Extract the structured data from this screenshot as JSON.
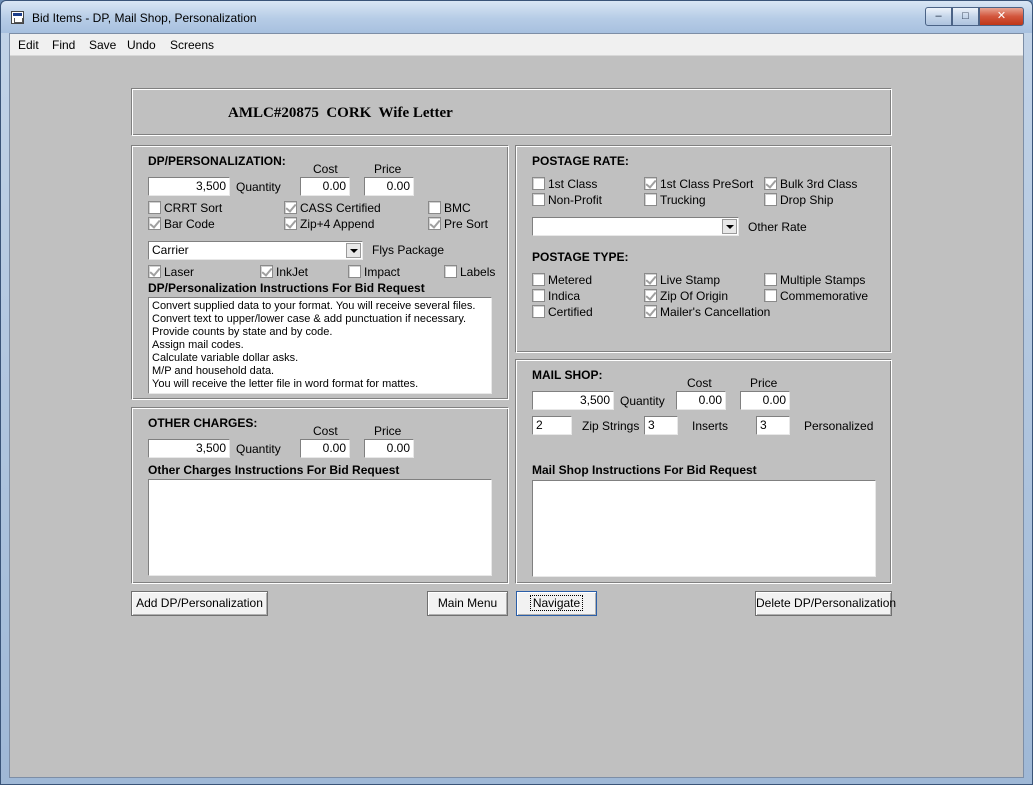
{
  "window": {
    "title": "Bid Items - DP, Mail Shop, Personalization",
    "min": "–",
    "max": "□",
    "close": "✕"
  },
  "menu": [
    "Edit",
    "Find",
    "Save",
    "Undo",
    "Screens"
  ],
  "header": {
    "job_title": "AMLC#20875  CORK  Wife Letter"
  },
  "dp": {
    "heading": "DP/PERSONALIZATION:",
    "cost_label": "Cost",
    "price_label": "Price",
    "quantity_value": "3,500",
    "quantity_label": "Quantity",
    "cost_value": "0.00",
    "price_value": "0.00",
    "options": [
      {
        "label": "CRRT Sort",
        "checked": false
      },
      {
        "label": "CASS Certified",
        "checked": true
      },
      {
        "label": "BMC",
        "checked": false
      },
      {
        "label": "Bar Code",
        "checked": true
      },
      {
        "label": "Zip+4 Append",
        "checked": true
      },
      {
        "label": "Pre Sort",
        "checked": true
      }
    ],
    "package_value": "Carrier",
    "package_label": "Flys Package",
    "print": [
      {
        "label": "Laser",
        "checked": true
      },
      {
        "label": "InkJet",
        "checked": true
      },
      {
        "label": "Impact",
        "checked": false
      },
      {
        "label": "Labels",
        "checked": false
      }
    ],
    "instructions_heading": "DP/Personalization Instructions For Bid Request",
    "instructions": [
      "Convert supplied data to your format. You will receive several files.",
      "Convert text to upper/lower case & add punctuation if necessary.",
      "Provide counts by state and by code.",
      "Assign mail codes.",
      "Calculate variable dollar asks.",
      "M/P and household data.",
      "You will receive the letter file in word format for mattes."
    ]
  },
  "other": {
    "heading": "OTHER CHARGES:",
    "cost_label": "Cost",
    "price_label": "Price",
    "quantity_value": "3,500",
    "quantity_label": "Quantity",
    "cost_value": "0.00",
    "price_value": "0.00",
    "instructions_heading": "Other Charges Instructions For Bid Request"
  },
  "postage_rate": {
    "heading": "POSTAGE RATE:",
    "options": [
      {
        "label": "1st Class",
        "checked": false
      },
      {
        "label": "1st Class PreSort",
        "checked": true
      },
      {
        "label": "Bulk 3rd Class",
        "checked": true
      },
      {
        "label": "Non-Profit",
        "checked": false
      },
      {
        "label": "Trucking",
        "checked": false
      },
      {
        "label": "Drop Ship",
        "checked": false
      }
    ],
    "other_rate_value": "",
    "other_rate_label": "Other Rate"
  },
  "postage_type": {
    "heading": "POSTAGE TYPE:",
    "options": [
      {
        "label": "Metered",
        "checked": false
      },
      {
        "label": "Live Stamp",
        "checked": true
      },
      {
        "label": "Multiple Stamps",
        "checked": false
      },
      {
        "label": "Indica",
        "checked": false
      },
      {
        "label": "Zip Of Origin",
        "checked": true
      },
      {
        "label": "Commemorative",
        "checked": false
      },
      {
        "label": "Certified",
        "checked": false
      },
      {
        "label": "Mailer's Cancellation",
        "checked": true
      }
    ]
  },
  "mail": {
    "heading": "MAIL SHOP:",
    "cost_label": "Cost",
    "price_label": "Price",
    "quantity_value": "3,500",
    "quantity_label": "Quantity",
    "cost_value": "0.00",
    "price_value": "0.00",
    "zip_value": "2",
    "zip_label": "Zip Strings",
    "inserts_value": "3",
    "inserts_label": "Inserts",
    "personalized_value": "3",
    "personalized_label": "Personalized",
    "instructions_heading": "Mail Shop Instructions For Bid Request"
  },
  "buttons": {
    "add": "Add DP/Personalization",
    "main_menu": "Main Menu",
    "navigate": "Navigate",
    "delete": "Delete DP/Personalization"
  }
}
